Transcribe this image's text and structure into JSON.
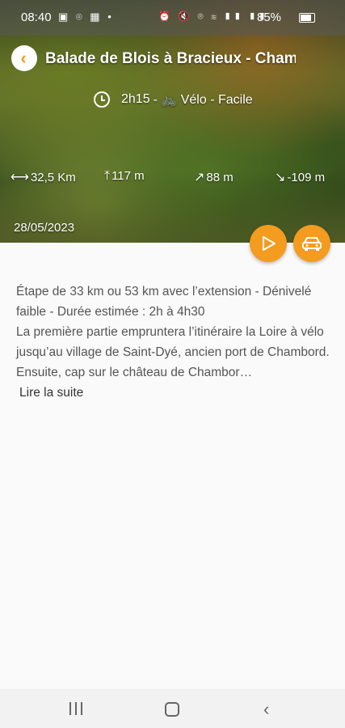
{
  "status_bar": {
    "time": "08:40",
    "battery": "85%",
    "left_icons": [
      "image-icon",
      "location-icon",
      "calendar-icon",
      "dot-icon"
    ],
    "right_icons": [
      "alarm-icon",
      "mute-icon",
      "location-icon",
      "wifi-icon",
      "signal-icon",
      "signal-icon"
    ]
  },
  "header": {
    "title": "Balade de Blois à Bracieux - Chambord",
    "duration": "2h15",
    "activity": "- 🚲 Vélo - Facile",
    "date": "28/05/2023"
  },
  "stats": {
    "distance": "32,5 Km",
    "max_altitude": "117 m",
    "ascent": "88 m",
    "descent": "-109 m"
  },
  "description": {
    "line1": "Étape de 33 km ou 53 km avec l’extension - Dénivelé faible - Durée estimée : 2h à 4h30",
    "line2": "La première partie empruntera l’itinéraire la Loire à vélo jusqu’au village de Saint-Dyé, ancien port de Chambord. Ensuite, cap sur le château de Chambor…",
    "read_more": "Lire la suite"
  },
  "colors": {
    "accent": "#f39c1f"
  }
}
